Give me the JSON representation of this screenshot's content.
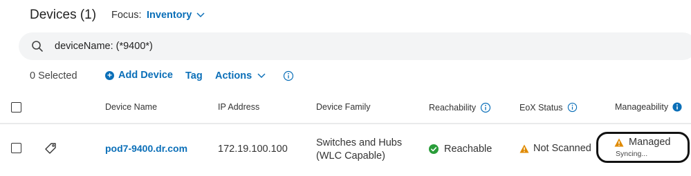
{
  "header": {
    "title": "Devices (1)",
    "focus_label": "Focus:",
    "focus_value": "Inventory"
  },
  "search": {
    "value": "deviceName: (*9400*)"
  },
  "toolbar": {
    "selected": "0 Selected",
    "add_device": "Add Device",
    "tag": "Tag",
    "actions": "Actions"
  },
  "table": {
    "columns": {
      "device_name": "Device Name",
      "ip_address": "IP Address",
      "device_family": "Device Family",
      "reachability": "Reachability",
      "eox_status": "EoX Status",
      "manageability": "Manageability"
    },
    "rows": [
      {
        "device_name": "pod7-9400.dr.com",
        "ip_address": "172.19.100.100",
        "device_family_line1": "Switches and Hubs",
        "device_family_line2": "(WLC Capable)",
        "reachability": "Reachable",
        "eox_status": "Not Scanned",
        "manageability": "Managed",
        "manageability_sub": "Syncing..."
      }
    ]
  },
  "colors": {
    "link": "#0b6fb8",
    "reachable": "#2a9d3a",
    "warning": "#e08a00"
  },
  "icons": [
    "chevron-down-icon",
    "search-icon",
    "plus-circle-icon",
    "info-icon",
    "tag-icon",
    "check-circle-icon",
    "warning-icon"
  ]
}
